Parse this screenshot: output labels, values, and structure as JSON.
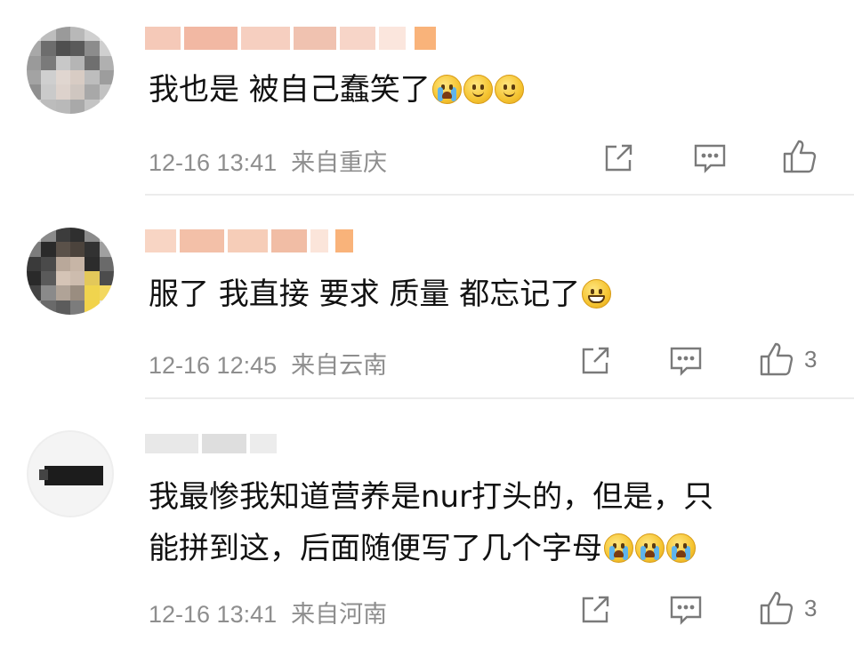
{
  "comments": [
    {
      "text": "我也是 被自己蠢笑了",
      "emojis": [
        "crying-face",
        "smiling-face",
        "smiling-face"
      ],
      "time": "12-16 13:41",
      "location": "来自重庆",
      "like_count": ""
    },
    {
      "text": "服了 我直接 要求 质量 都忘记了",
      "emojis": [
        "grinning-face"
      ],
      "time": "12-16 12:45",
      "location": "来自云南",
      "like_count": "3"
    },
    {
      "text_line1": "我最惨我知道营养是nur打头的，但是，只",
      "text_line2": "能拼到这，后面随便写了几个字母",
      "emojis": [
        "crying-face",
        "crying-face",
        "crying-face"
      ],
      "time": "12-16 13:41",
      "location": "来自河南",
      "like_count": "3"
    }
  ],
  "icons": {
    "share": "share-icon",
    "reply": "comment-icon",
    "like": "thumbs-up-icon"
  },
  "colors": {
    "meta_text": "#8e8e8e",
    "body_text": "#111111",
    "divider": "#ececec"
  }
}
